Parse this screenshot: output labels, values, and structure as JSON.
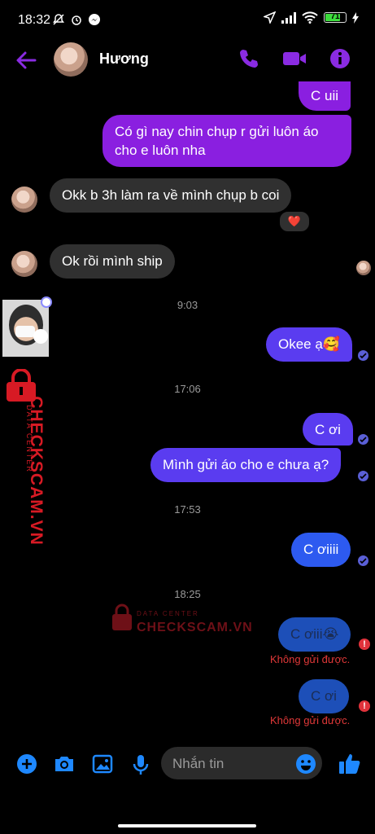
{
  "status_bar": {
    "time": "18:32",
    "battery": "71"
  },
  "header": {
    "contact_name": "Hương"
  },
  "messages": [
    {
      "text": "C uii"
    },
    {
      "text": "Có gì nay chin chụp r gửi luôn áo cho e luôn nha"
    },
    {
      "text": "Okk b 3h làm ra về mình chụp b coi",
      "reaction": "❤️"
    },
    {
      "text": "Ok rồi mình ship"
    },
    {
      "text": "Okee ạ🥰"
    },
    {
      "text": "C ơi"
    },
    {
      "text": "Mình gửi áo cho e chưa ạ?"
    },
    {
      "text": "C ơiiii"
    },
    {
      "text": "C ơiii😭"
    },
    {
      "text": "C ơi"
    }
  ],
  "timestamps": [
    "9:03",
    "17:06",
    "17:53",
    "18:25"
  ],
  "errors": {
    "not_sent": "Không gửi được.",
    "mark": "!"
  },
  "composer": {
    "placeholder": "Nhắn tin"
  },
  "watermark": {
    "brand": "CHECKSCAM.VN",
    "sub": "DATA CENTER"
  },
  "colors": {
    "accent": "#8a2be2",
    "messenger_blue": "#1e88ff",
    "error": "#e0323b"
  }
}
